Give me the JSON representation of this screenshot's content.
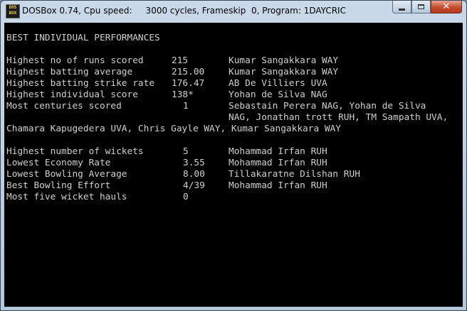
{
  "window": {
    "title": "DOSBox 0.74, Cpu speed:     3000 cycles, Frameskip  0, Program: 1DAYCRIC",
    "icon_text": "DOS BOX",
    "close_glyph": "✕"
  },
  "screen": {
    "heading": "BEST INDIVIDUAL PERFORMANCES",
    "batting": [
      {
        "label": "Highest no of runs scored",
        "value": "215",
        "player": "Kumar Sangakkara WAY"
      },
      {
        "label": "Highest batting average",
        "value": "215.00",
        "player": "Kumar Sangakkara WAY"
      },
      {
        "label": "Highest batting strike rate",
        "value": "176.47",
        "player": "AB De Villiers UVA"
      },
      {
        "label": "Highest individual score",
        "value": "138*",
        "player": "Yohan de Silva NAG"
      },
      {
        "label": "Most centuries scored",
        "value": "1",
        "player": "Sebastain Perera NAG, Yohan de Silva"
      }
    ],
    "centuries_cont_1": "NAG, Jonathan trott RUH, TM Sampath UVA,",
    "centuries_cont_2": "Chamara Kapugedera UVA, Chris Gayle WAY, Kumar Sangakkara WAY",
    "bowling": [
      {
        "label": "Highest number of wickets",
        "value": "5",
        "player": "Mohammad Irfan RUH"
      },
      {
        "label": "Lowest Economy Rate",
        "value": "3.55",
        "player": "Mohammad Irfan RUH"
      },
      {
        "label": "Lowest Bowling Average",
        "value": "8.00",
        "player": "Tillakaratne Dilshan RUH"
      },
      {
        "label": "Best Bowling Effort",
        "value": "4/39",
        "player": "Mohammad Irfan RUH"
      },
      {
        "label": "Most five wicket hauls",
        "value": "0",
        "player": ""
      }
    ],
    "colors": {
      "text": "#cfcfcf",
      "background": "#000000"
    }
  }
}
